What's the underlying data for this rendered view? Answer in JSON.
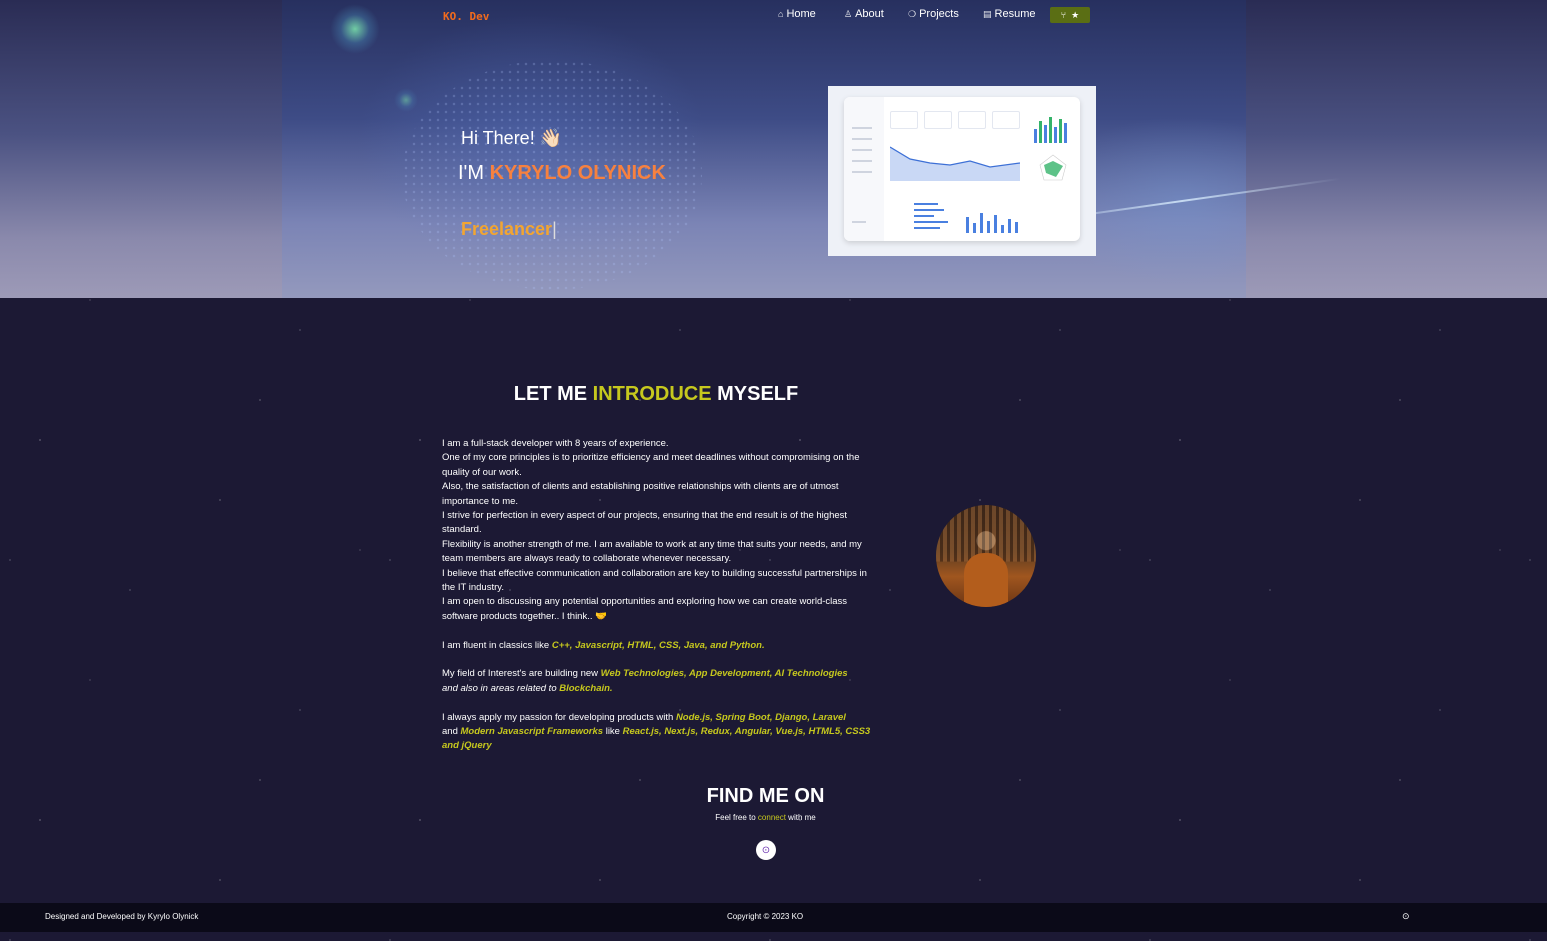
{
  "brand": {
    "logo": "KO. Dev"
  },
  "nav": {
    "items": [
      {
        "icon": "home-icon",
        "glyph": "⌂",
        "label": "Home"
      },
      {
        "icon": "user-icon",
        "glyph": "♙",
        "label": "About"
      },
      {
        "icon": "projects-icon",
        "glyph": "❍",
        "label": "Projects"
      },
      {
        "icon": "document-icon",
        "glyph": "▤",
        "label": "Resume"
      }
    ],
    "github_button": {
      "fork_glyph": "⑂",
      "star_glyph": "★"
    }
  },
  "hero": {
    "greeting": "Hi There!",
    "wave": "👋🏻",
    "im_prefix": "I'M ",
    "name": "KYRYLO OLYNICK",
    "role": "Freelancer",
    "cursor": "|"
  },
  "about": {
    "title_a": "LET ME ",
    "title_hl": "INTRODUCE",
    "title_b": " MYSELF",
    "paragraphs": [
      "I am a full-stack developer with 8 years of experience.",
      "One of my core principles is to prioritize efficiency and meet deadlines without compromising on the quality of our work.",
      "Also, the satisfaction of clients and establishing positive relationships with clients are of utmost importance to me.",
      "I strive for perfection in every aspect of our projects, ensuring that the end result is of the highest standard.",
      "Flexibility is another strength of me. I am available to work at any time that suits your needs, and my team members are always ready to collaborate whenever necessary.",
      "I believe that effective communication and collaboration are key to building successful partnerships in the IT industry.",
      "I am open to discussing any potential opportunities and exploring how we can create world-class software products together.. I think.. 🤝"
    ],
    "langs_prefix": "I am fluent in classics like ",
    "langs": "C++, Javascript, HTML, CSS, Java, and Python.",
    "interest_prefix": "My field of Interest's are building new ",
    "interests": " Web Technologies,  App Development,  AI Technologies",
    "interest_mid": " and also in areas related to ",
    "interest_end": "Blockchain.",
    "passion_prefix": "I always apply my passion for developing products with ",
    "backends": "Node.js,  Spring Boot,  Django,  Laravel",
    "passion_and": " and ",
    "frameworks": " Modern Javascript Frameworks",
    "passion_like": "  like ",
    "libs": "React.js,  Next.js,  Redux,  Angular,  Vue.js,  HTML5,  CSS3 and  jQuery"
  },
  "find": {
    "title": "FIND ME ON",
    "sub_a": "Feel free to ",
    "sub_link": "connect",
    "sub_b": " with me",
    "social_icon": "github-icon",
    "social_glyph": "⊙"
  },
  "footer": {
    "left": "Designed and Developed by Kyrylo Olynick",
    "center": "Copyright © 2023 KO",
    "right_glyph": "⊙"
  },
  "colors": {
    "accent_yellow": "#c6c81e",
    "name_orange": "#f7813f",
    "role_orange": "#f2a531",
    "logo_orange": "#f26b1d",
    "bg": "#1c1934",
    "footer_bg": "#0b0a18",
    "button_green": "#5a6e14"
  }
}
